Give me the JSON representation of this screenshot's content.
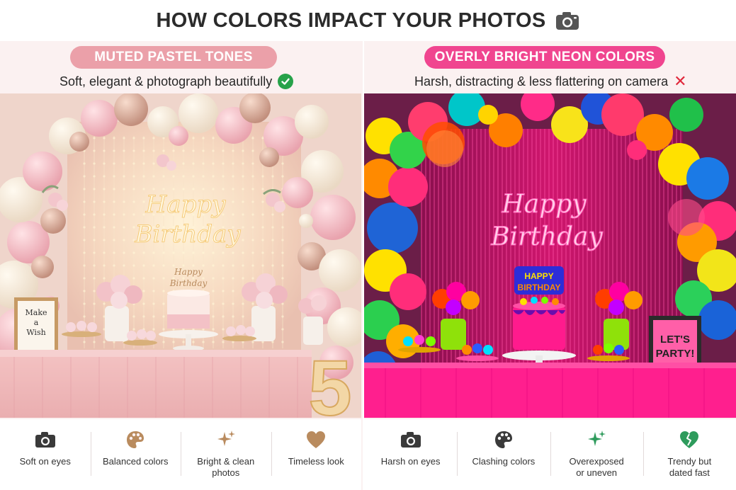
{
  "header": {
    "title": "HOW COLORS IMPACT YOUR PHOTOS",
    "icon": "camera-icon"
  },
  "left_panel": {
    "badge": "MUTED PASTEL TONES",
    "subtitle": "Soft, elegant & photograph beautifully",
    "subtitle_icon": "check-icon",
    "photo": {
      "neon_sign_line1": "Happy",
      "neon_sign_line2": "Birthday",
      "cake_topper_line1": "Happy",
      "cake_topper_line2": "Birthday",
      "frame_text": [
        "Make",
        "a",
        "Wish"
      ],
      "marquee_number": "5"
    },
    "features": [
      {
        "label": "Soft on eyes",
        "icon": "camera-icon"
      },
      {
        "label": "Balanced colors",
        "icon": "palette-icon"
      },
      {
        "label": "Bright & clean photos",
        "icon": "sparkle-icon"
      },
      {
        "label": "Timeless look",
        "icon": "heart-icon"
      }
    ],
    "colors": {
      "badge": "#eba0a9",
      "icon": "#b98b5e"
    }
  },
  "right_panel": {
    "badge": "OVERLY BRIGHT NEON COLORS",
    "subtitle": "Harsh, distracting & less flattering on camera",
    "subtitle_icon": "cross-icon",
    "photo": {
      "neon_sign_line1": "Happy",
      "neon_sign_line2": "Birthday",
      "cake_topper_line1": "HAPPY",
      "cake_topper_line2": "BIRTHDAY",
      "frame_text": [
        "LET'S",
        "PARTY!"
      ]
    },
    "features": [
      {
        "label": "Harsh on eyes",
        "icon": "camera-icon"
      },
      {
        "label": "Clashing colors",
        "icon": "palette-icon"
      },
      {
        "label": "Overexposed or uneven",
        "icon": "sparkle-icon"
      },
      {
        "label": "Trendy but dated fast",
        "icon": "broken-heart-icon"
      }
    ],
    "colors": {
      "badge": "#f0458f",
      "icon": "#3a3a3a",
      "icon_green": "#2e9b5c"
    }
  }
}
